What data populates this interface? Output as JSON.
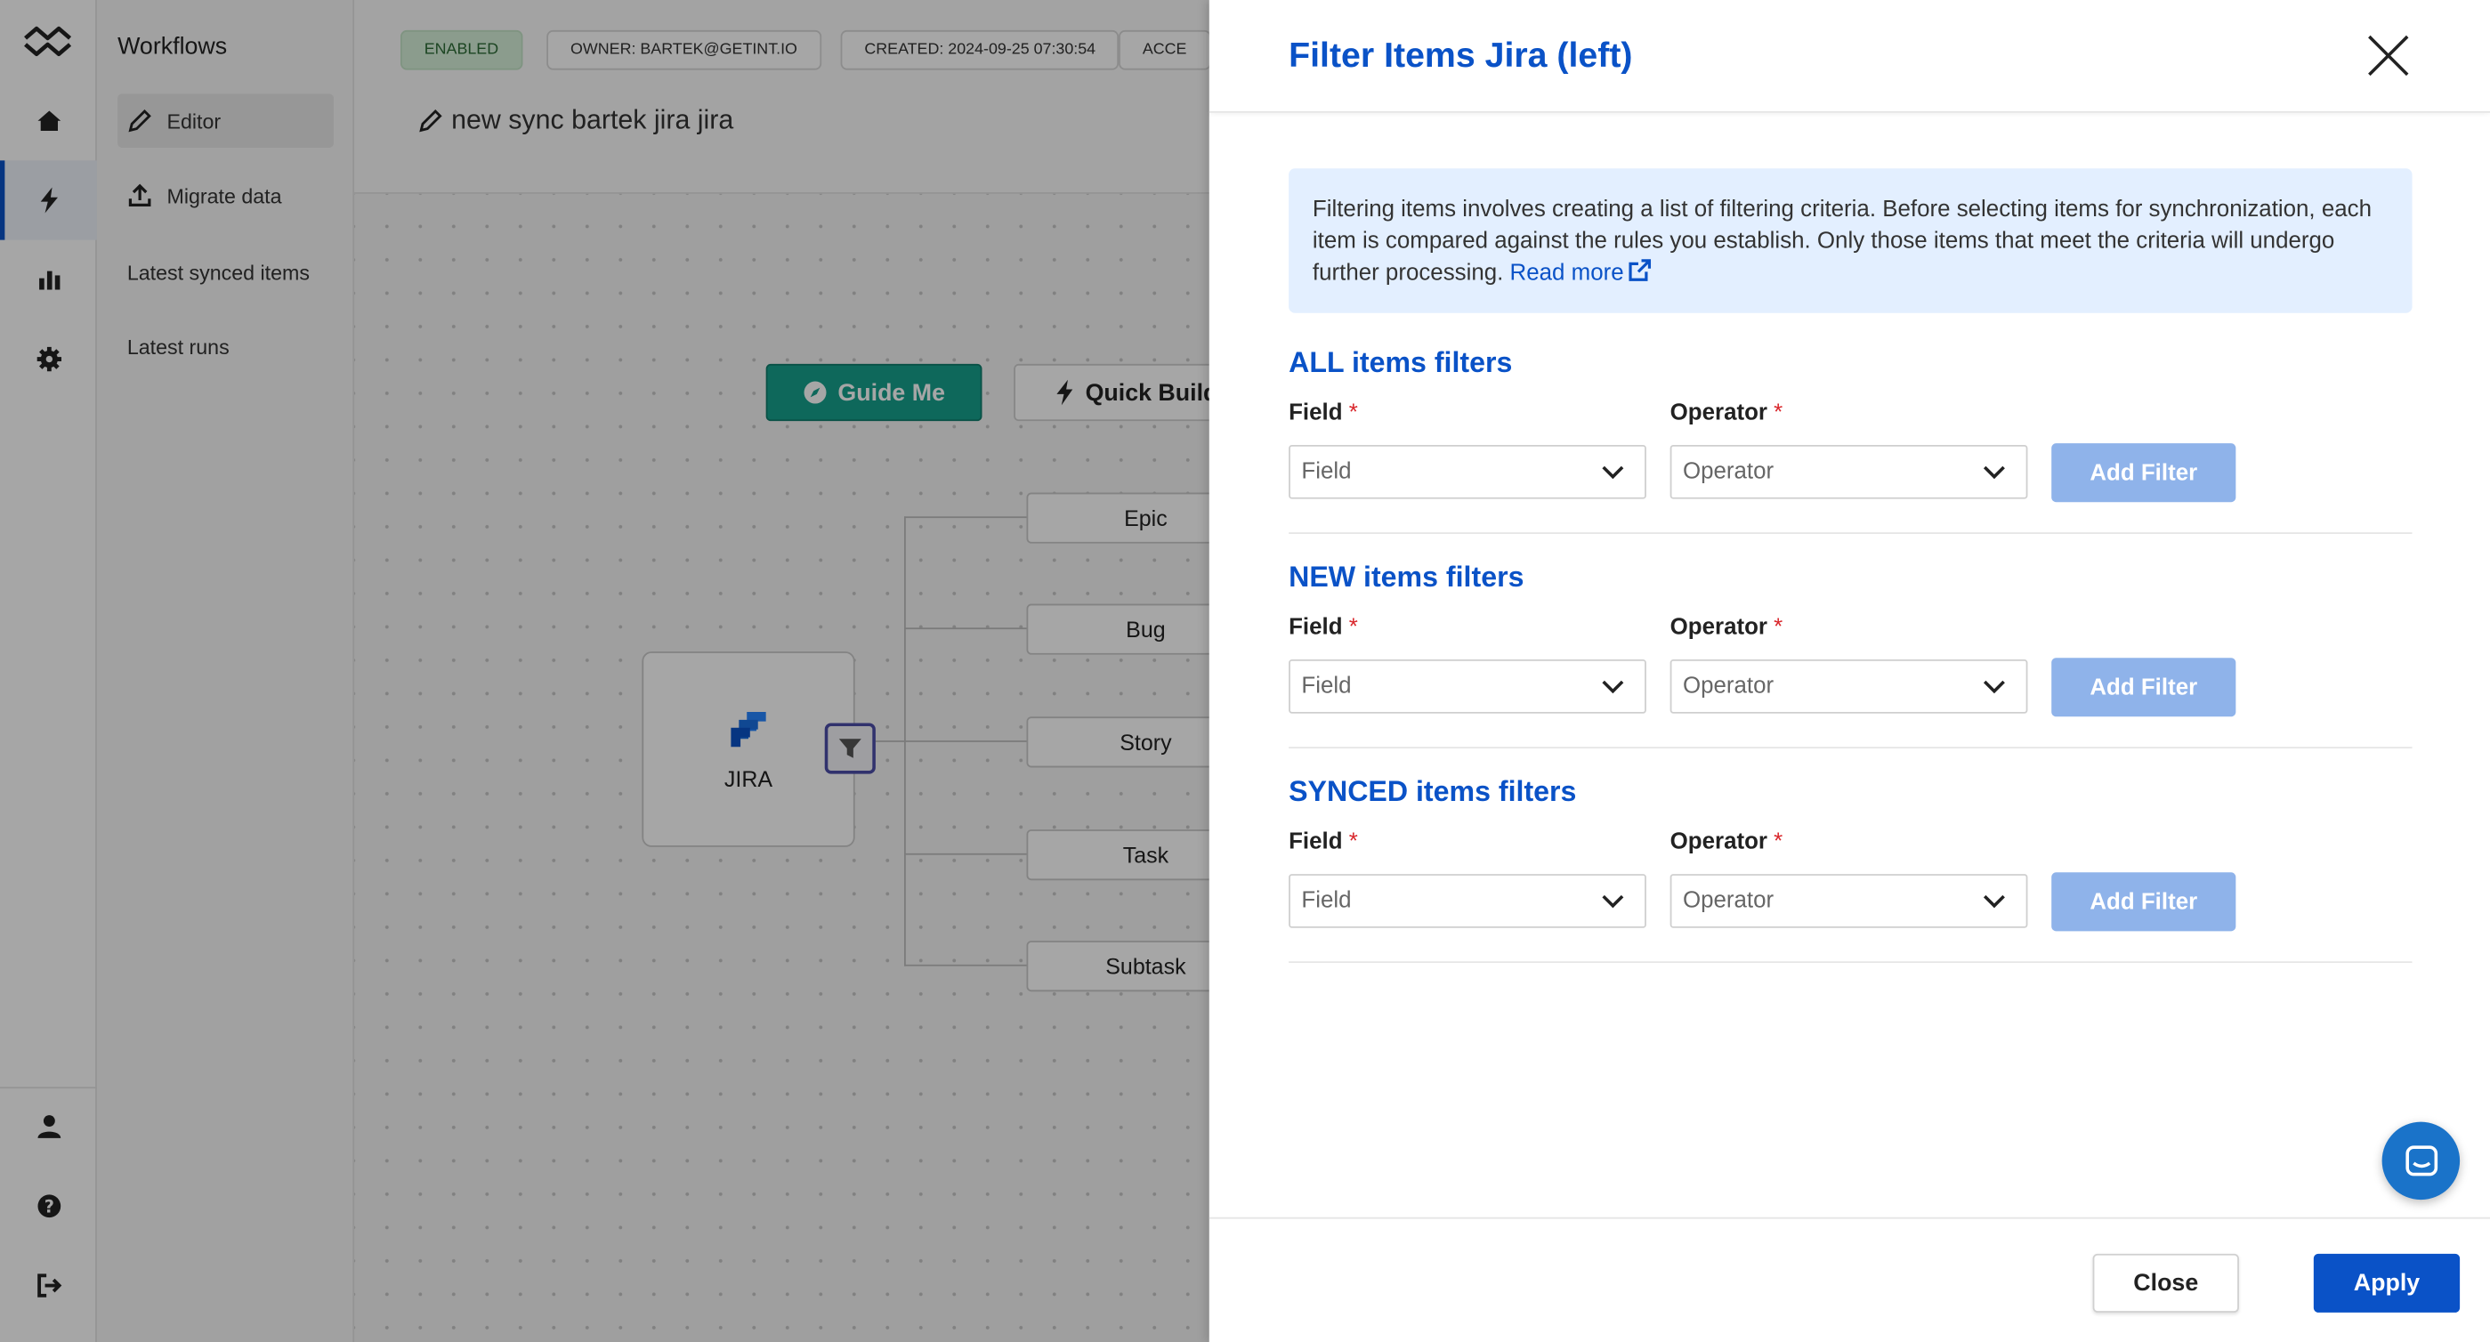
{
  "sidebar": {
    "section_title": "Workflows",
    "items": [
      {
        "label": "Editor"
      },
      {
        "label": "Migrate data"
      },
      {
        "label": "Latest synced items"
      },
      {
        "label": "Latest runs"
      }
    ]
  },
  "header": {
    "chips": {
      "status": "ENABLED",
      "owner": "OWNER: BARTEK@GETINT.IO",
      "created": "CREATED: 2024-09-25 07:30:54",
      "access": "ACCE"
    },
    "sync_name": "new sync bartek jira jira"
  },
  "canvas": {
    "guide_me": "Guide Me",
    "quick_build": "Quick Build",
    "app_node": "JIRA",
    "types": [
      "Epic",
      "Bug",
      "Story",
      "Task",
      "Subtask"
    ]
  },
  "drawer": {
    "title": "Filter Items Jira (left)",
    "info_text": "Filtering items involves creating a list of filtering criteria. Before selecting items for synchronization, each item is compared against the rules you establish. Only those items that meet the criteria will undergo further processing.",
    "read_more": "Read more",
    "sections": [
      {
        "title": "ALL items filters",
        "field_label": "Field",
        "operator_label": "Operator",
        "field_placeholder": "Field",
        "operator_placeholder": "Operator",
        "add_label": "Add Filter"
      },
      {
        "title": "NEW items filters",
        "field_label": "Field",
        "operator_label": "Operator",
        "field_placeholder": "Field",
        "operator_placeholder": "Operator",
        "add_label": "Add Filter"
      },
      {
        "title": "SYNCED items filters",
        "field_label": "Field",
        "operator_label": "Operator",
        "field_placeholder": "Field",
        "operator_placeholder": "Operator",
        "add_label": "Add Filter"
      }
    ],
    "required_mark": "*",
    "close_label": "Close",
    "apply_label": "Apply"
  },
  "colors": {
    "primary": "#0a52c7",
    "guide_green": "#16a08c",
    "disabled_button": "#8fb3ea",
    "info_bg": "#e3efff"
  },
  "icons": {
    "rail": [
      "logo-icon",
      "home-icon",
      "bolt-icon",
      "chart-icon",
      "gear-icon",
      "user-icon",
      "help-icon",
      "logout-icon"
    ]
  }
}
